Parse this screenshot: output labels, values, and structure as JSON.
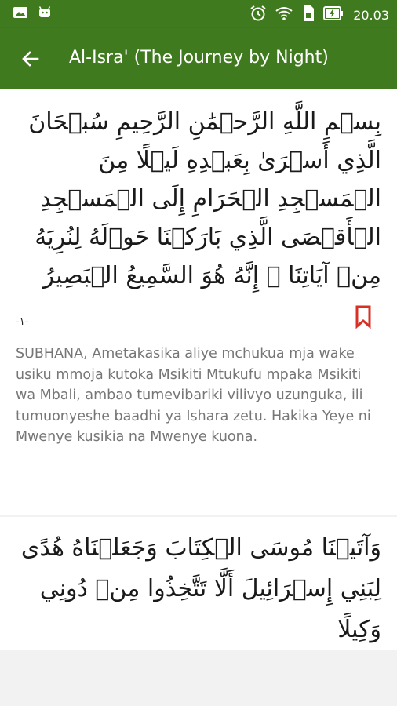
{
  "status_bar": {
    "time": "20.03",
    "left_icons": [
      "image-icon",
      "android-icon"
    ],
    "right_icons": [
      "alarm-icon",
      "wifi-icon",
      "sim-icon",
      "battery-charging-icon"
    ]
  },
  "app_bar": {
    "title": "Al-Isra' (The Journey by Night)",
    "back_icon": "arrow-left-icon"
  },
  "verses": [
    {
      "arabic": "بِسۡمِ اللَّهِ الرَّحۡمَٰنِ الرَّحِيمِ سُبۡحَانَ الَّذِي أَسۡرَىٰ بِعَبۡدِهِ لَيۡلًا مِنَ الۡمَسۡجِدِ الۡحَرَامِ إِلَى الۡمَسۡجِدِ الۡأَقۡصَى الَّذِي بَارَكۡنَا حَوۡلَهُ لِنُرِيَهُ مِنۡ آيَاتِنَا ۚ إِنَّهُ هُوَ السَّمِيعُ الۡبَصِيرُ",
      "number_label": "-١-",
      "translation": "SUBHANA, Ametakasika aliye mchukua mja wake usiku mmoja kutoka Msikiti Mtukufu mpaka Msikiti wa Mbali, ambao tumevibariki vilivyo uzunguka, ili tumuonyeshe baadhi ya Ishara zetu. Hakika Yeye ni Mwenye kusikia na Mwenye kuona."
    },
    {
      "arabic": "وَآتَيۡنَا مُوسَى الۡكِتَابَ وَجَعَلۡنَاهُ هُدًى لِبَنِي إِسۡرَائِيلَ أَلَّا تَتَّخِذُوا مِنۡ دُونِي وَكِيلًا"
    }
  ],
  "colors": {
    "primary": "#3f7a1e",
    "bookmark": "#d93025",
    "translation_text": "#767676",
    "background": "#f2f2f2"
  }
}
